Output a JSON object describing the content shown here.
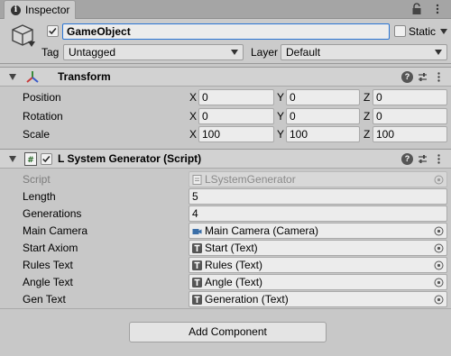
{
  "window": {
    "tab_label": "Inspector",
    "lock_icon": "lock-icon",
    "menu_icon": "kebab-menu-icon"
  },
  "header": {
    "active": true,
    "name": "GameObject",
    "static_label": "Static",
    "static_checked": false,
    "tag_label": "Tag",
    "tag_value": "Untagged",
    "layer_label": "Layer",
    "layer_value": "Default"
  },
  "transform": {
    "title": "Transform",
    "rows": [
      {
        "label": "Position",
        "x": "0",
        "y": "0",
        "z": "0"
      },
      {
        "label": "Rotation",
        "x": "0",
        "y": "0",
        "z": "0"
      },
      {
        "label": "Scale",
        "x": "100",
        "y": "100",
        "z": "100"
      }
    ],
    "axis_x": "X",
    "axis_y": "Y",
    "axis_z": "Z"
  },
  "script_component": {
    "title": "L System Generator (Script)",
    "enabled": true,
    "fields": [
      {
        "label": "Script",
        "value": "LSystemGenerator",
        "kind": "script"
      },
      {
        "label": "Length",
        "value": "5",
        "kind": "number"
      },
      {
        "label": "Generations",
        "value": "4",
        "kind": "number"
      },
      {
        "label": "Main Camera",
        "value": "Main Camera (Camera)",
        "kind": "camera"
      },
      {
        "label": "Start Axiom",
        "value": "Start (Text)",
        "kind": "text"
      },
      {
        "label": "Rules Text",
        "value": "Rules (Text)",
        "kind": "text"
      },
      {
        "label": "Angle Text",
        "value": "Angle (Text)",
        "kind": "text"
      },
      {
        "label": "Gen Text",
        "value": "Generation (Text)",
        "kind": "text"
      }
    ]
  },
  "add_component_label": "Add Component",
  "colors": {
    "accent": "#2a75d4",
    "panel": "#c8c8c8"
  }
}
